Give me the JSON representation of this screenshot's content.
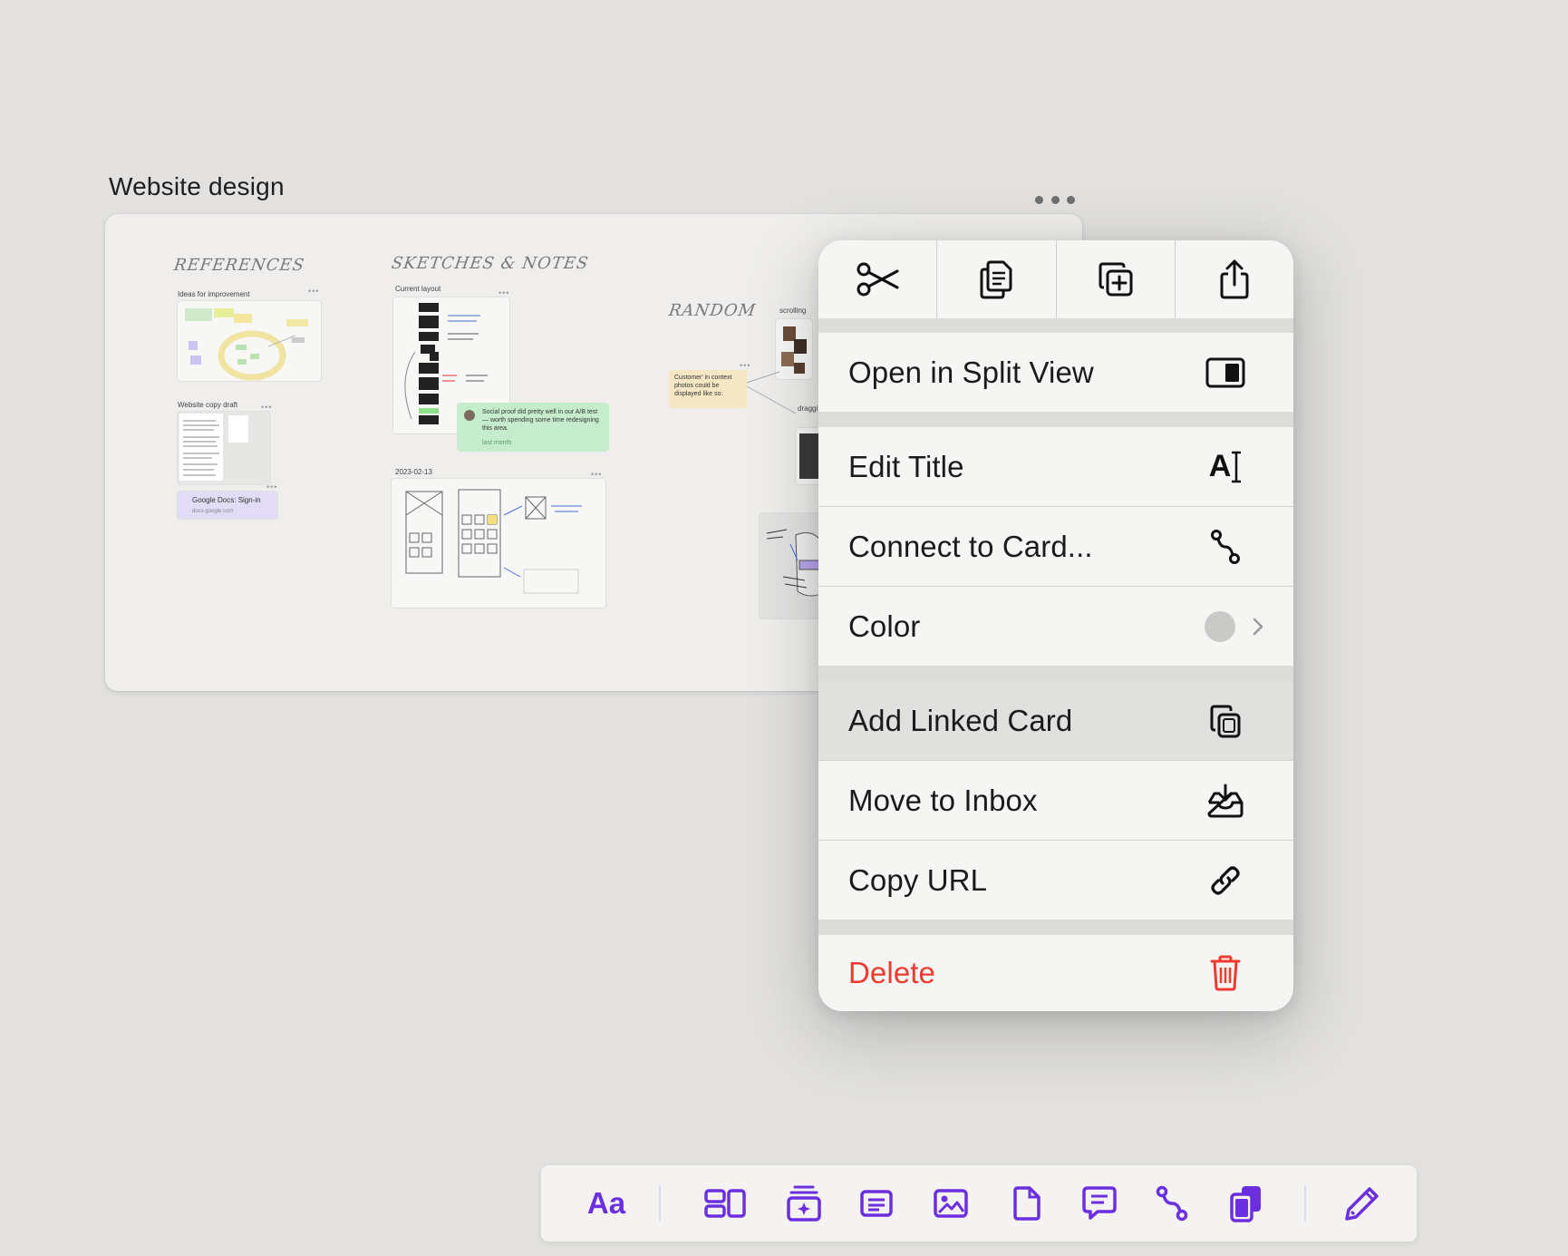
{
  "card": {
    "title": "Website design",
    "sections": {
      "references": "References",
      "sketches": "Sketches & Notes",
      "random": "Random"
    },
    "mini": {
      "ideas": "Ideas for improvement",
      "copy_draft": "Website copy draft",
      "current_layout": "Current layout",
      "date": "2023-02-13",
      "gdocs_title": "Google Docs: Sign-in",
      "gdocs_url": "docs.google.com",
      "social_proof": "Social proof did pretty well in our A/B test — worth spending some time redesigning this area.",
      "last_month": "last month",
      "customer_photos": "Customer' in context photos could be displayed like so:",
      "scrolling": "scrolling",
      "dragging": "draggi"
    }
  },
  "menu": {
    "toolbar": [
      {
        "name": "cut",
        "icon": "scissors-icon"
      },
      {
        "name": "copy",
        "icon": "copy-icon"
      },
      {
        "name": "duplicate",
        "icon": "duplicate-icon"
      },
      {
        "name": "share",
        "icon": "share-icon"
      }
    ],
    "items": {
      "split_view": "Open in Split View",
      "edit_title": "Edit Title",
      "connect": "Connect to Card...",
      "color": "Color",
      "add_linked": "Add Linked Card",
      "move_inbox": "Move to Inbox",
      "copy_url": "Copy URL",
      "delete": "Delete"
    },
    "edit_title_icon_text": "A",
    "current_color": "#c9c9c8",
    "danger_color": "#ef3b2d"
  },
  "bottom_toolbar": {
    "text_tool": "Aa",
    "accent": "#6b2fe0",
    "tools": [
      "text-icon",
      "board-icon",
      "new-card-icon",
      "note-icon",
      "image-icon",
      "document-icon",
      "comment-icon",
      "connect-icon",
      "linked-cards-icon",
      "pen-icon"
    ]
  }
}
